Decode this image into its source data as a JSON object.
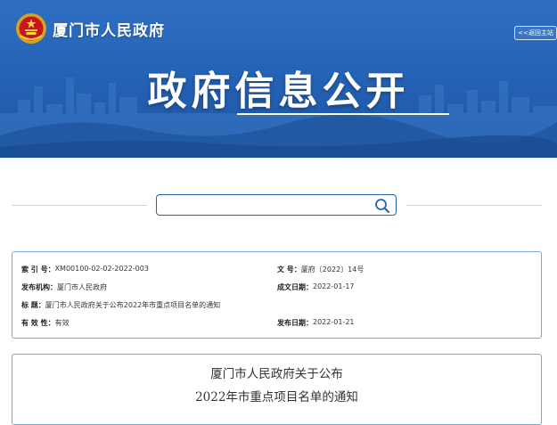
{
  "header": {
    "site_name": "厦门市人民政府",
    "back_link_label": "<<返回主站",
    "banner_title": "政府信息公开",
    "emblem_icon": "national-emblem-icon",
    "colors": {
      "banner": "#2563b6",
      "text": "#ffffff"
    }
  },
  "search": {
    "placeholder": "",
    "value": "",
    "icon": "search-icon"
  },
  "info": {
    "index_label": "索 引 号：",
    "index_value": "XM00100-02-02-2022-003",
    "doc_no_label": "文        号：",
    "doc_no_value": "厦府〔2022〕14号",
    "issuer_label": "发布机构：",
    "issuer_value": "厦门市人民政府",
    "written_date_label": "成文日期：",
    "written_date_value": "2022-01-17",
    "title_label": "标        题：",
    "title_value": "厦门市人民政府关于公布2022年市重点项目名单的通知",
    "validity_label": "有 效 性：",
    "validity_value": "有效",
    "publish_date_label": "发布日期：",
    "publish_date_value": "2022-01-21"
  },
  "document": {
    "title_line1": "厦门市人民政府关于公布",
    "title_line2": "2022年市重点项目名单的通知"
  },
  "colors": {
    "panel_border": "#7ea6d8",
    "search_border": "#2b64a8"
  }
}
